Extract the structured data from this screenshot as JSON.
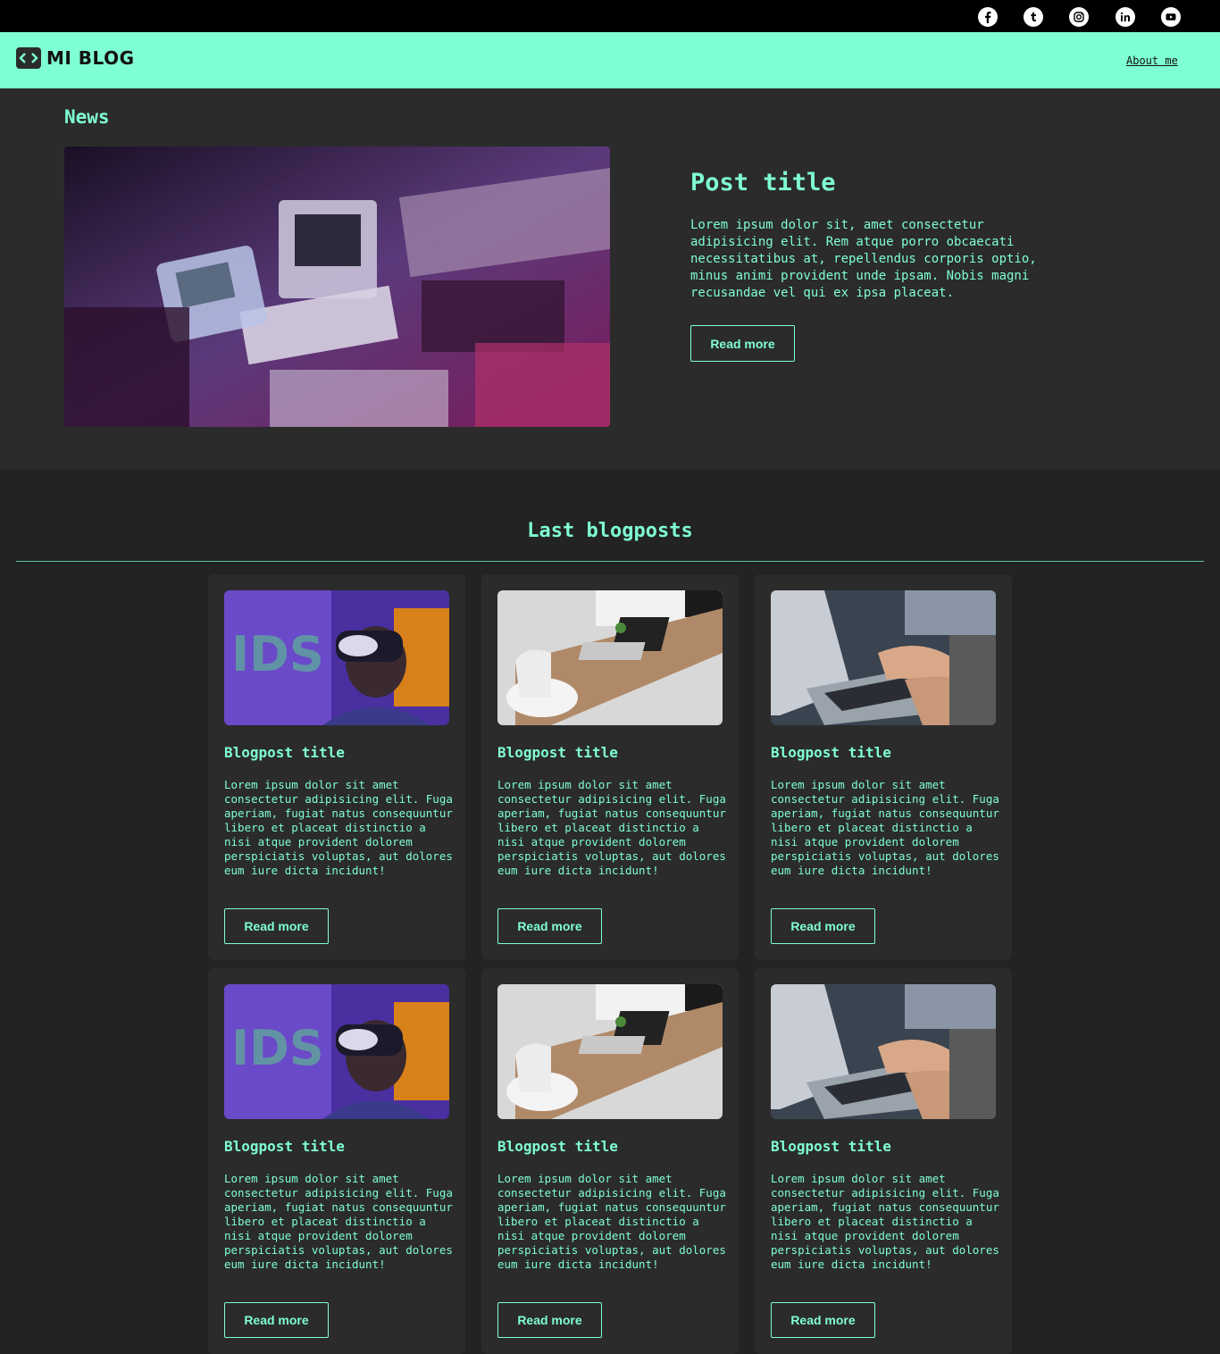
{
  "social": [
    "facebook-icon",
    "tumblr-icon",
    "instagram-icon",
    "linkedin-icon",
    "youtube-icon"
  ],
  "header": {
    "logo_text": "MI BLOG",
    "about_label": "About me"
  },
  "news": {
    "label": "News",
    "post_title": "Post title",
    "post_text": "Lorem ipsum dolor sit, amet consectetur adipisicing elit. Rem atque porro obcaecati necessitatibus at, repellendus corporis optio, minus animi provident unde ipsam. Nobis magni recusandae vel qui ex ipsa placeat.",
    "button_label": "Read more"
  },
  "blog": {
    "section_title": "Last blogposts",
    "cards": [
      {
        "title": "Blogpost title",
        "text": "Lorem ipsum dolor sit amet consectetur adipisicing elit. Fuga aperiam, fugiat natus consequuntur libero et placeat distinctio a nisi atque provident dolorem perspiciatis voluptas, aut dolores eum iure dicta incidunt!",
        "button": "Read more",
        "image": "vr-headset"
      },
      {
        "title": "Blogpost title",
        "text": "Lorem ipsum dolor sit amet consectetur adipisicing elit. Fuga aperiam, fugiat natus consequuntur libero et placeat distinctio a nisi atque provident dolorem perspiciatis voluptas, aut dolores eum iure dicta incidunt!",
        "button": "Read more",
        "image": "laptop-desk"
      },
      {
        "title": "Blogpost title",
        "text": "Lorem ipsum dolor sit amet consectetur adipisicing elit. Fuga aperiam, fugiat natus consequuntur libero et placeat distinctio a nisi atque provident dolorem perspiciatis voluptas, aut dolores eum iure dicta incidunt!",
        "button": "Read more",
        "image": "typing-hands"
      },
      {
        "title": "Blogpost title",
        "text": "Lorem ipsum dolor sit amet consectetur adipisicing elit. Fuga aperiam, fugiat natus consequuntur libero et placeat distinctio a nisi atque provident dolorem perspiciatis voluptas, aut dolores eum iure dicta incidunt!",
        "button": "Read more",
        "image": "vr-headset"
      },
      {
        "title": "Blogpost title",
        "text": "Lorem ipsum dolor sit amet consectetur adipisicing elit. Fuga aperiam, fugiat natus consequuntur libero et placeat distinctio a nisi atque provident dolorem perspiciatis voluptas, aut dolores eum iure dicta incidunt!",
        "button": "Read more",
        "image": "laptop-desk"
      },
      {
        "title": "Blogpost title",
        "text": "Lorem ipsum dolor sit amet consectetur adipisicing elit. Fuga aperiam, fugiat natus consequuntur libero et placeat distinctio a nisi atque provident dolorem perspiciatis voluptas, aut dolores eum iure dicta incidunt!",
        "button": "Read more",
        "image": "typing-hands"
      }
    ]
  },
  "colors": {
    "accent": "#7fffd4",
    "page_bg": "#222322",
    "panel_bg": "#2b2b2b",
    "topbar": "#000000"
  }
}
